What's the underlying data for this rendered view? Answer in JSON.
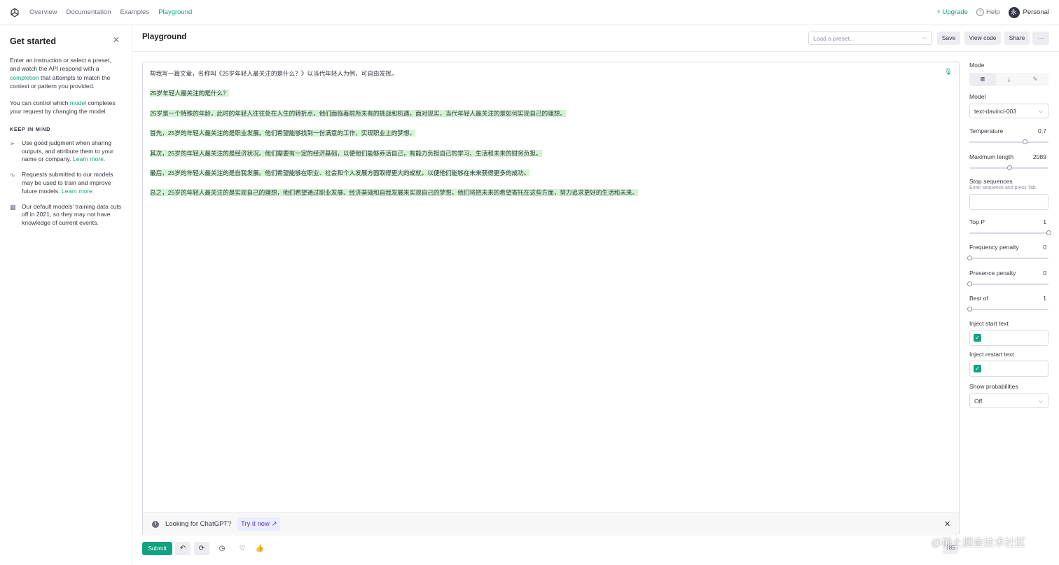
{
  "nav": {
    "links": [
      "Overview",
      "Documentation",
      "Examples",
      "Playground"
    ],
    "active": "Playground",
    "upgrade": "Upgrade",
    "help": "Help",
    "avatar_initial": "永",
    "account": "Personal"
  },
  "sidebar": {
    "title": "Get started",
    "intro_a": "Enter an instruction or select a preset, and watch the API respond with a ",
    "intro_link": "completion",
    "intro_b": " that attempts to match the context or pattern you provided.",
    "model_a": "You can control which ",
    "model_link": "model",
    "model_b": " completes your request by changing the model.",
    "keep_heading": "KEEP IN MIND",
    "tips": [
      {
        "icon": "send-icon",
        "text": "Use good judgment when sharing outputs, and attribute them to your name or company. ",
        "link": "Learn more."
      },
      {
        "icon": "activity-icon",
        "text": "Requests submitted to our models may be used to train and improve future models. ",
        "link": "Learn more."
      },
      {
        "icon": "calendar-icon",
        "text": "Our default models' training data cuts off in 2021, so they may not have knowledge of current events.",
        "link": ""
      }
    ]
  },
  "header": {
    "title": "Playground",
    "preset_placeholder": "Load a preset...",
    "save": "Save",
    "view_code": "View code",
    "share": "Share",
    "more": "···"
  },
  "editor": {
    "prompt": "帮我写一篇文章，名称叫《25岁年轻人最关注的是什么？》以当代年轻人为例，可自由发挥。",
    "completion": [
      "25岁年轻人最关注的是什么？",
      "25岁是一个特殊的年龄，此时的年轻人往往处在人生的转折点，他们面临着前所未有的挑战和机遇。面对现实，当代年轻人最关注的是如何实现自己的理想。",
      "首先，25岁的年轻人最关注的是职业发展。他们希望能够找到一份满意的工作，实现职业上的梦想。",
      "其次，25岁的年轻人最关注的是经济状况。他们需要有一定的经济基础，以便他们能够养活自己，有能力负担自己的学习、生活和未来的财务负担。",
      "最后，25岁的年轻人最关注的是自我发展。他们希望能够在职业、社会和个人发展方面取得更大的成就，以便他们能够在未来获得更多的成功。",
      "总之，25岁的年轻人最关注的是实现自己的理想，他们希望通过职业发展、经济基础和自我发展来实现自己的梦想。他们将把未来的希望寄托在这些方面，努力追求更好的生活和未来。"
    ],
    "banner_text": "Looking for ChatGPT?",
    "banner_link": "Try it now"
  },
  "footer": {
    "submit": "Submit",
    "token_count": "785"
  },
  "settings": {
    "mode_label": "Mode",
    "model_label": "Model",
    "model_value": "text-davinci-003",
    "temperature": {
      "label": "Temperature",
      "value": "0.7",
      "fraction": 0.7
    },
    "max_length": {
      "label": "Maximum length",
      "value": "2089",
      "fraction": 0.51
    },
    "stop_label": "Stop sequences",
    "stop_hint": "Enter sequence and press Tab",
    "top_p": {
      "label": "Top P",
      "value": "1",
      "fraction": 1.0
    },
    "freq": {
      "label": "Frequency penalty",
      "value": "0",
      "fraction": 0.0
    },
    "presence": {
      "label": "Presence penalty",
      "value": "0",
      "fraction": 0.0
    },
    "best_of": {
      "label": "Best of",
      "value": "1",
      "fraction": 0.0
    },
    "inject_start_label": "Inject start text",
    "inject_restart_label": "Inject restart text",
    "show_prob_label": "Show probabilities",
    "show_prob_value": "Off"
  },
  "watermark": "@稀土掘金技术社区",
  "colors": {
    "accent": "#10a37f",
    "highlight": "#d2f4d3",
    "link_purple": "#5436da"
  }
}
